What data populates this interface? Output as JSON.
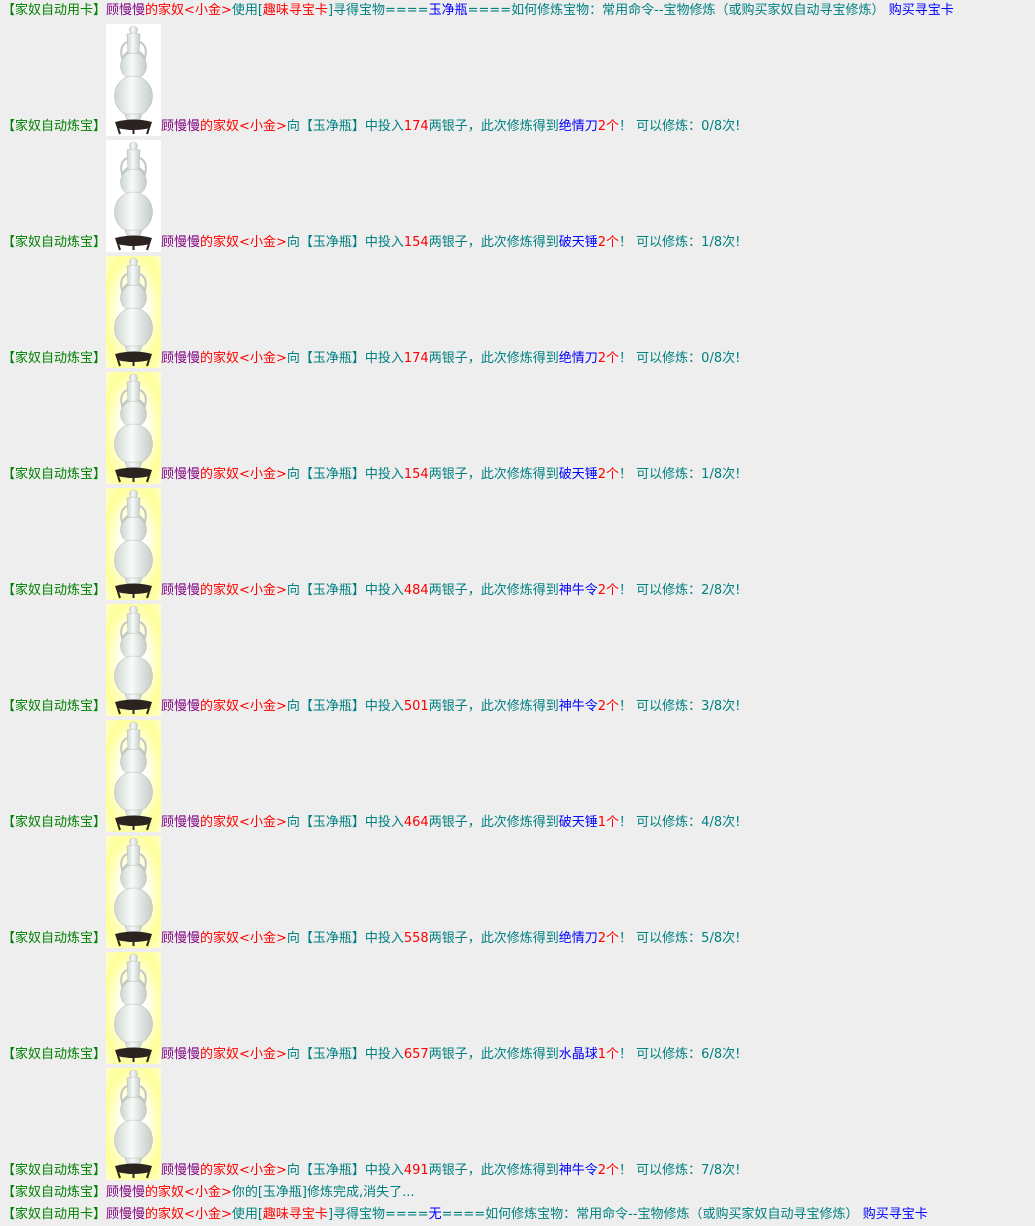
{
  "top_line": {
    "tag": "【家奴自动用卡】",
    "owner": "顾慢慢",
    "owner_suffix": "的家奴",
    "servant": "<小金>",
    "use_prefix": "使用[",
    "card_name": "趣味寻宝卡",
    "found_prefix": "]寻得宝物====",
    "treasure": "玉净瓶",
    "found_suffix": "====如何修炼宝物：常用命令--宝物修炼（或购买家奴自动寻宝修炼）",
    "buy_link": "购买寻宝卡"
  },
  "refine_common": {
    "tag": "【家奴自动炼宝】",
    "owner": "顾慢慢",
    "owner_suffix": "的家奴",
    "servant": "<小金>",
    "to_prefix": "向【",
    "treasure": "玉净瓶",
    "invest_prefix": "】中投入",
    "invest_suffix": "两银子，此次修炼得到",
    "can_prefix": "！ 可以修炼：",
    "can_suffix": "次!"
  },
  "entries": [
    {
      "silver": "174",
      "item": "绝情刀",
      "count": "2个",
      "progress": "0/8"
    },
    {
      "silver": "154",
      "item": "破天锤",
      "count": "2个",
      "progress": "1/8"
    },
    {
      "silver": "174",
      "item": "绝情刀",
      "count": "2个",
      "progress": "0/8"
    },
    {
      "silver": "154",
      "item": "破天锤",
      "count": "2个",
      "progress": "1/8"
    },
    {
      "silver": "484",
      "item": "神牛令",
      "count": "2个",
      "progress": "2/8"
    },
    {
      "silver": "501",
      "item": "神牛令",
      "count": "2个",
      "progress": "3/8"
    },
    {
      "silver": "464",
      "item": "破天锤",
      "count": "1个",
      "progress": "4/8"
    },
    {
      "silver": "558",
      "item": "绝情刀",
      "count": "2个",
      "progress": "5/8"
    },
    {
      "silver": "657",
      "item": "水晶球",
      "count": "1个",
      "progress": "6/8"
    },
    {
      "silver": "491",
      "item": "神牛令",
      "count": "2个",
      "progress": "7/8"
    }
  ],
  "complete_line": {
    "tag": "【家奴自动炼宝】",
    "owner": "顾慢慢",
    "owner_suffix": "的家奴",
    "servant": "<小金>",
    "message": "你的[玉净瓶]修炼完成,消失了..."
  },
  "bottom_line": {
    "tag": "【家奴自动用卡】",
    "owner": "顾慢慢",
    "owner_suffix": "的家奴",
    "servant": "<小金>",
    "use_prefix": "使用[",
    "card_name": "趣味寻宝卡",
    "found_prefix": "]寻得宝物====",
    "treasure": "无",
    "found_suffix": "====如何修炼宝物：常用命令--宝物修炼（或购买家奴自动寻宝修炼）",
    "buy_link": "购买寻宝卡"
  },
  "vase_icon": "jade-vase-icon",
  "colors": {
    "background": "#eeeeee",
    "tag": "#008000",
    "owner": "#800080",
    "highlight": "#ff0000",
    "text": "#008080",
    "item": "#0000ff"
  }
}
